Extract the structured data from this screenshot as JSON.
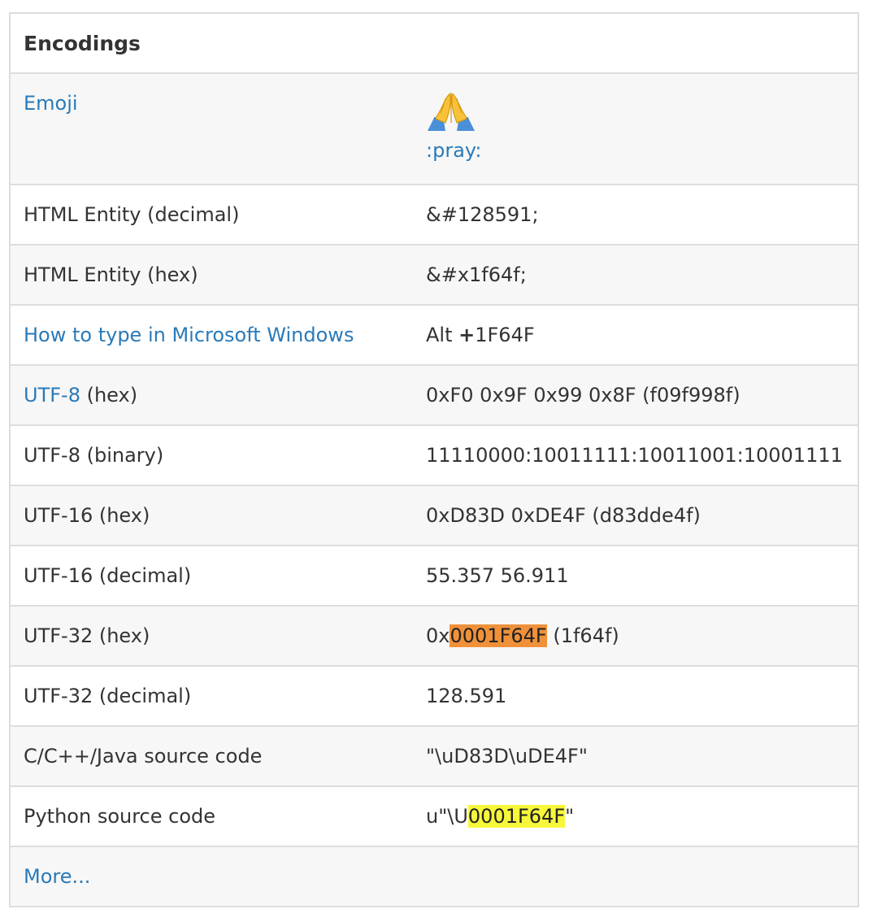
{
  "panel": {
    "title": "Encodings"
  },
  "rows": {
    "emoji": {
      "label": "Emoji",
      "shortcode": ":pray:",
      "icon": "folded-hands-emoji"
    },
    "html_decimal": {
      "label": "HTML Entity (decimal)",
      "value": "&#128591;"
    },
    "html_hex": {
      "label": "HTML Entity (hex)",
      "value": "&#x1f64f;"
    },
    "windows": {
      "label": "How to type in Microsoft Windows",
      "value_prefix": "Alt ",
      "value_plus": "+",
      "value_code": "1F64F"
    },
    "utf8_hex": {
      "label_link": "UTF-8",
      "label_rest": " (hex)",
      "value": "0xF0 0x9F 0x99 0x8F (f09f998f)"
    },
    "utf8_bin": {
      "label": "UTF-8 (binary)",
      "value": "11110000:10011111:10011001:10001111"
    },
    "utf16_hex": {
      "label": "UTF-16 (hex)",
      "value": "0xD83D 0xDE4F (d83dde4f)"
    },
    "utf16_dec": {
      "label": "UTF-16 (decimal)",
      "value": "55.357 56.911"
    },
    "utf32_hex": {
      "label": "UTF-32 (hex)",
      "value_prefix": "0x",
      "value_highlight": "0001F64F",
      "value_suffix": " (1f64f)",
      "highlight_color": "#f0913a"
    },
    "utf32_dec": {
      "label": "UTF-32 (decimal)",
      "value": "128.591"
    },
    "cjava": {
      "label": "C/C++/Java source code",
      "value": "\"\\uD83D\\uDE4F\""
    },
    "python": {
      "label": "Python source code",
      "value_prefix": "u\"\\U",
      "value_highlight": "0001F64F",
      "value_suffix": "\"",
      "highlight_color": "#f7f73a"
    },
    "more": {
      "label": "More..."
    }
  }
}
